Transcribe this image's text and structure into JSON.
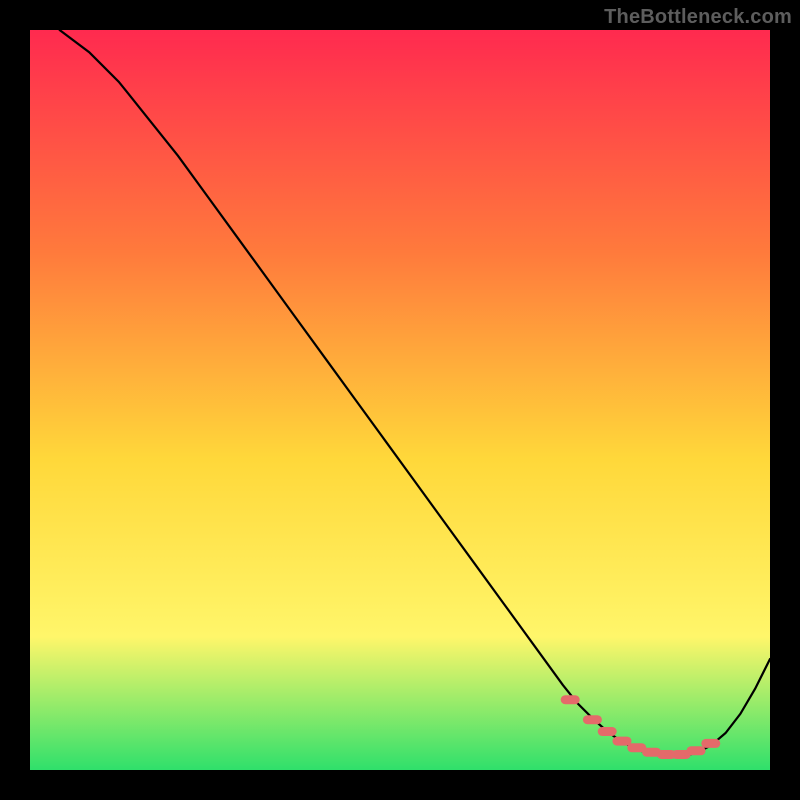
{
  "watermark": "TheBottleneck.com",
  "colors": {
    "gradient_top": "#ff2a4f",
    "gradient_mid1": "#ff7a3c",
    "gradient_mid2": "#ffd83a",
    "gradient_mid3": "#fff66a",
    "gradient_bottom": "#2fe06b",
    "curve": "#000000",
    "markers": "#e46a6a",
    "frame": "#000000"
  },
  "chart_data": {
    "type": "line",
    "title": "",
    "xlabel": "",
    "ylabel": "",
    "xlim": [
      0,
      100
    ],
    "ylim": [
      0,
      100
    ],
    "grid": false,
    "legend": false,
    "series": [
      {
        "name": "bottleneck-curve",
        "x": [
          4,
          8,
          12,
          16,
          20,
          24,
          28,
          32,
          36,
          40,
          44,
          48,
          52,
          56,
          60,
          64,
          68,
          72,
          74,
          76,
          78,
          80,
          82,
          84,
          86,
          88,
          90,
          92,
          94,
          96,
          98,
          100
        ],
        "y": [
          100,
          97,
          93,
          88,
          83,
          77.5,
          72,
          66.5,
          61,
          55.5,
          50,
          44.5,
          39,
          33.5,
          28,
          22.5,
          17,
          11.5,
          9,
          7,
          5.2,
          3.8,
          2.8,
          2.1,
          1.8,
          1.8,
          2.3,
          3.3,
          5,
          7.6,
          11,
          15
        ]
      }
    ],
    "markers": {
      "name": "highlight-points",
      "x": [
        73,
        76,
        78,
        80,
        82,
        84,
        86,
        88,
        90,
        92
      ],
      "y": [
        9.5,
        6.8,
        5.2,
        3.9,
        3.0,
        2.4,
        2.1,
        2.1,
        2.6,
        3.6
      ]
    }
  }
}
